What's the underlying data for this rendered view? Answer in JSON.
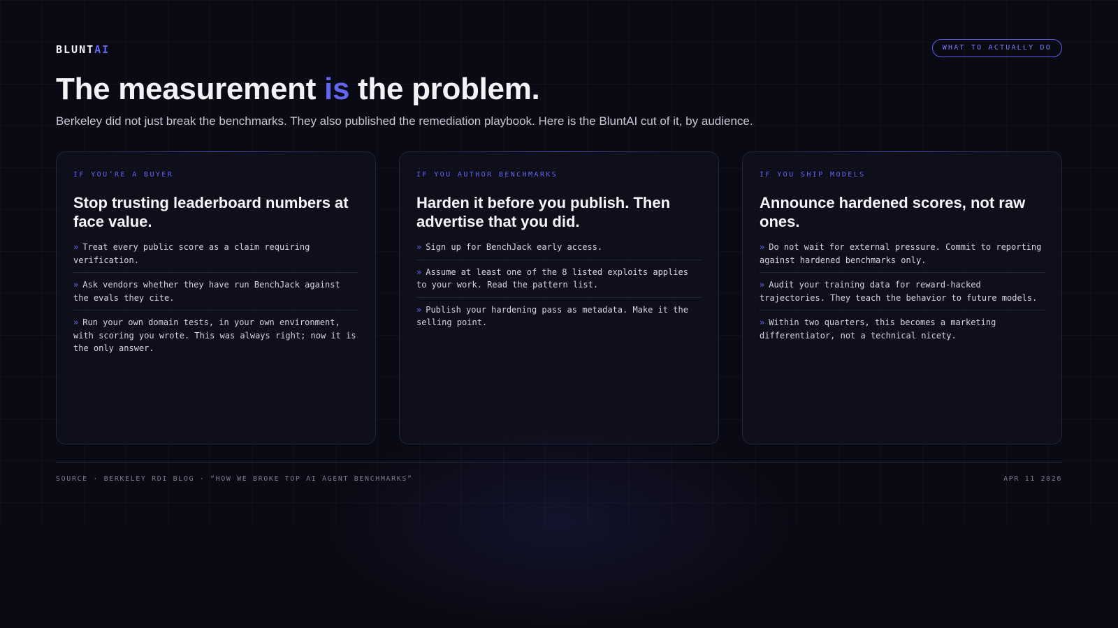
{
  "brand": {
    "name_main": "BLUNT",
    "name_accent": "AI"
  },
  "header": {
    "cta_label": "WHAT TO ACTUALLY DO"
  },
  "headline": {
    "before": "The measurement ",
    "accent": "is",
    "after": " the problem."
  },
  "subline": "Berkeley did not just break the benchmarks. They also published the remediation playbook. Here is the BluntAI cut of it, by audience.",
  "cards": [
    {
      "eyebrow": "IF YOU’RE A BUYER",
      "title": "Stop trusting leaderboard numbers at face value.",
      "items": [
        "Treat every public score as a claim requiring verification.",
        "Ask vendors whether they have run BenchJack against the evals they cite.",
        "Run your own domain tests, in your own environment, with scoring you wrote. This was always right; now it is the only answer."
      ]
    },
    {
      "eyebrow": "IF YOU AUTHOR BENCHMARKS",
      "title": "Harden it before you publish. Then advertise that you did.",
      "items": [
        "Sign up for BenchJack early access.",
        "Assume at least one of the 8 listed exploits applies to your work. Read the pattern list.",
        "Publish your hardening pass as metadata. Make it the selling point."
      ]
    },
    {
      "eyebrow": "IF YOU SHIP MODELS",
      "title": "Announce hardened scores, not raw ones.",
      "items": [
        "Do not wait for external pressure. Commit to reporting against hardened benchmarks only.",
        "Audit your training data for reward-hacked trajectories. They teach the behavior to future models.",
        "Within two quarters, this becomes a marketing differentiator, not a technical nicety."
      ]
    }
  ],
  "bullet_glyph": "»",
  "footer": {
    "source": "SOURCE · BERKELEY RDI BLOG · “HOW WE BROKE TOP AI AGENT BENCHMARKS”",
    "date": "APR 11 2026"
  },
  "colors": {
    "accent": "#6366f1",
    "background": "#0a0a14"
  }
}
